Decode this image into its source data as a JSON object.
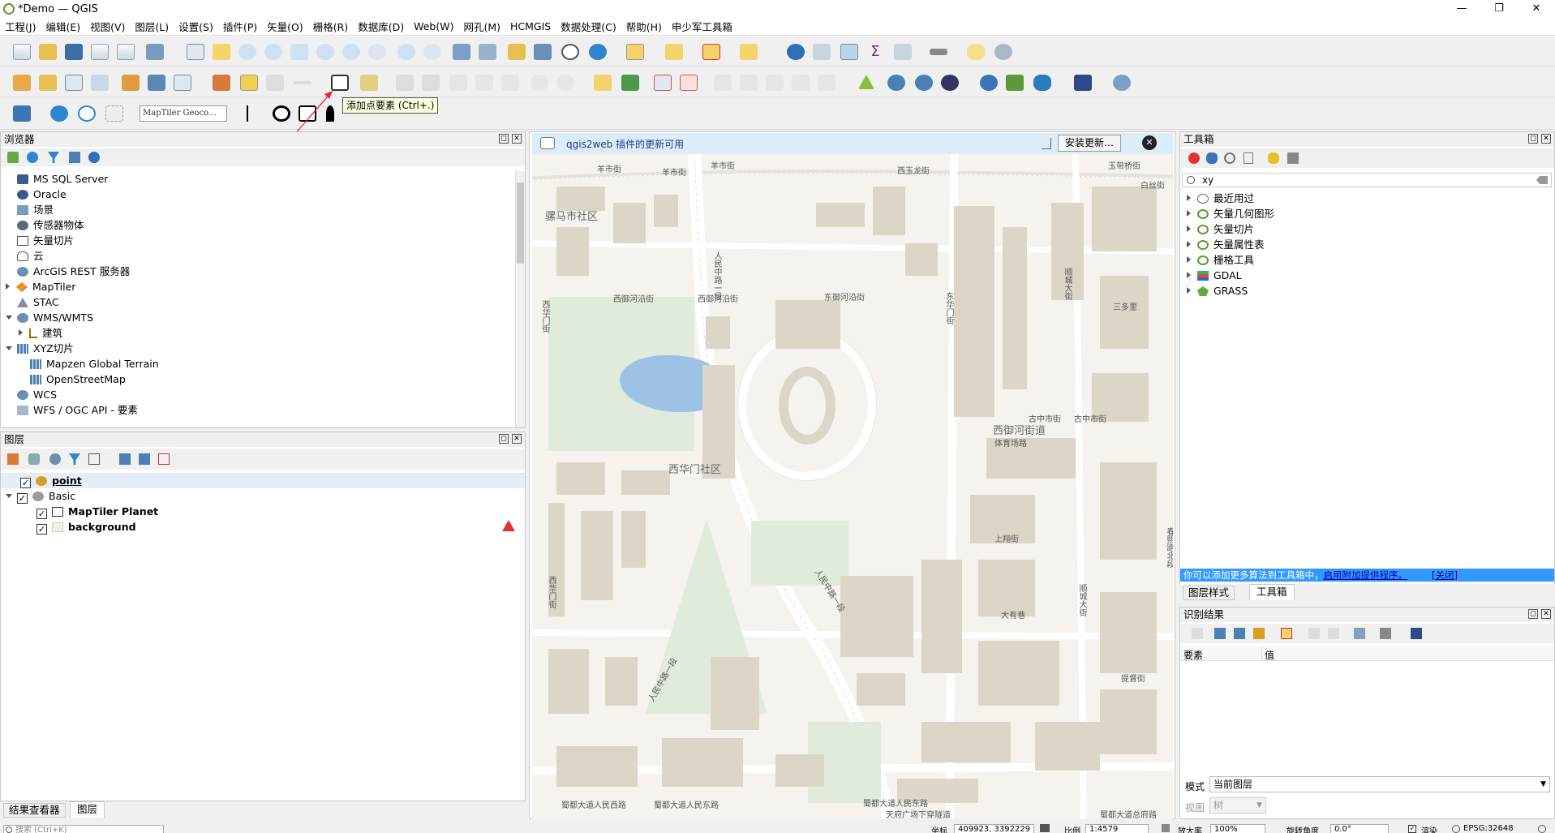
{
  "window": {
    "title": "*Demo — QGIS"
  },
  "menu": [
    "工程(J)",
    "编辑(E)",
    "视图(V)",
    "图层(L)",
    "设置(S)",
    "插件(P)",
    "矢量(O)",
    "栅格(R)",
    "数据库(D)",
    "Web(W)",
    "网孔(M)",
    "HCMGIS",
    "数据处理(C)",
    "帮助(H)",
    "申少军工具箱"
  ],
  "toolbar": {
    "geocoder_placeholder": "MapTiler Geoco…",
    "tooltip": "添加点要素 (Ctrl+.)"
  },
  "browser": {
    "title": "浏览器",
    "items": [
      "MS SQL Server",
      "Oracle",
      "场景",
      "传感器物体",
      "矢量切片",
      "云",
      "ArcGIS REST 服务器",
      "MapTiler",
      "STAC",
      "WMS/WMTS",
      "建筑",
      "XYZ切片",
      "Mapzen Global Terrain",
      "OpenStreetMap",
      "WCS",
      "WFS / OGC API - 要素"
    ]
  },
  "layers": {
    "title": "图层",
    "items": [
      "point",
      "Basic",
      "MapTiler Planet",
      "background"
    ]
  },
  "bottom_tabs": [
    "结果查看器",
    "图层"
  ],
  "search": {
    "placeholder": "搜索 (Ctrl+K)"
  },
  "notification": {
    "text": "qgis2web 插件的更新可用",
    "button": "安装更新…"
  },
  "map_labels": {
    "big": [
      "骡马市社区",
      "西华门社区",
      "西御河街道"
    ],
    "small": [
      "羊市街",
      "羊市街",
      "羊市街",
      "西玉龙街",
      "玉带桥街",
      "白丝街",
      "人民中路一段",
      "西御河沿街",
      "西御河沿街",
      "东御河沿街",
      "东华门街",
      "西华门街",
      "顺城大街",
      "三多里",
      "古中市街",
      "古中市街",
      "体育场路",
      "上翔街",
      "人民中路一段",
      "人民中路一段",
      "顺城大街",
      "大有巷",
      "西华门街",
      "蜀都大道人民西路",
      "蜀都大道人民东路",
      "蜀都大道人民东路",
      "天府广场下穿隧道",
      "蜀都大道总府路",
      "提督街",
      "春熙路北段"
    ]
  },
  "toolbox": {
    "title": "工具箱",
    "search_value": "xy",
    "items": [
      "最近用过",
      "矢量几何图形",
      "矢量切片",
      "矢量属性表",
      "栅格工具",
      "GDAL",
      "GRASS"
    ],
    "info_text": "你可以添加更多算法到工具箱中，",
    "info_link": "启用附加提供程序。",
    "info_close": "[关闭]",
    "tabs": [
      "图层样式",
      "工具箱"
    ]
  },
  "identify": {
    "title": "识别结果",
    "columns": [
      "要素",
      "值"
    ],
    "mode_label": "模式",
    "mode_value": "当前图层",
    "view_label": "视图",
    "view_value": "树"
  },
  "status": {
    "coord_label": "坐标",
    "coord_value": "409923, 3392229",
    "scale_label": "比例",
    "scale_value": "1:4579",
    "zoom_label": "放大率",
    "zoom_value": "100%",
    "rotation_label": "旋转角度",
    "rotation_value": "0.0°",
    "render_label": "渲染",
    "crs": "EPSG:32648"
  }
}
